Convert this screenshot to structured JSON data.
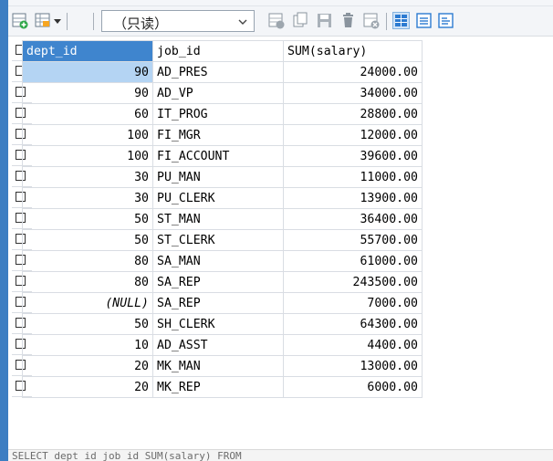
{
  "toolbar": {
    "readonly_label": "（只读）",
    "icons": [
      "add-row-icon",
      "grid-menu-icon",
      "dropdown-arrow-icon",
      "insert-icon",
      "copy-icon",
      "save-icon",
      "delete-icon",
      "refresh-icon",
      "grid-view-icon",
      "form-view-icon",
      "text-view-icon"
    ]
  },
  "table": {
    "columns": [
      "dept_id",
      "job_id",
      "SUM(salary)"
    ],
    "rows": [
      [
        "90",
        "AD_PRES",
        "24000.00"
      ],
      [
        "90",
        "AD_VP",
        "34000.00"
      ],
      [
        "60",
        "IT_PROG",
        "28800.00"
      ],
      [
        "100",
        "FI_MGR",
        "12000.00"
      ],
      [
        "100",
        "FI_ACCOUNT",
        "39600.00"
      ],
      [
        "30",
        "PU_MAN",
        "11000.00"
      ],
      [
        "30",
        "PU_CLERK",
        "13900.00"
      ],
      [
        "50",
        "ST_MAN",
        "36400.00"
      ],
      [
        "50",
        "ST_CLERK",
        "55700.00"
      ],
      [
        "80",
        "SA_MAN",
        "61000.00"
      ],
      [
        "80",
        "SA_REP",
        "243500.00"
      ],
      [
        "(NULL)",
        "SA_REP",
        "7000.00"
      ],
      [
        "50",
        "SH_CLERK",
        "64300.00"
      ],
      [
        "10",
        "AD_ASST",
        "4400.00"
      ],
      [
        "20",
        "MK_MAN",
        "13000.00"
      ],
      [
        "20",
        "MK_REP",
        "6000.00"
      ]
    ]
  },
  "status": {
    "sql_text": "SELECT dept_id job_id SUM(salary) FROM"
  },
  "colors": {
    "header_selected": "#3f85ce",
    "row_selected": "#b4d4f3",
    "frame": "#3d7ec2"
  }
}
